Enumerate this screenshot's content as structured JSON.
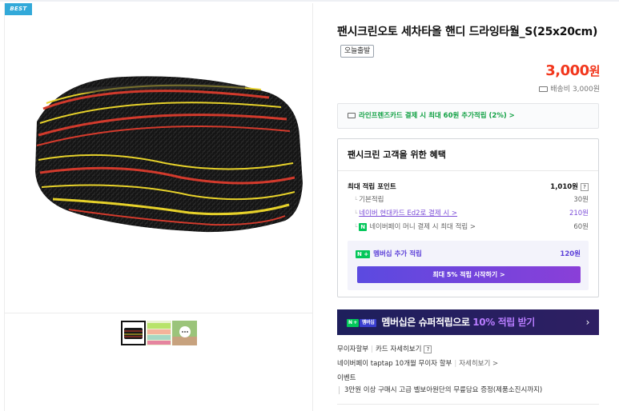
{
  "badge": "BEST",
  "product": {
    "title": "팬시크린오토 세차타올 핸디 드라잉타월_S(25x20cm)",
    "today_ship_badge": "오늘출발",
    "price": "3,000",
    "price_unit": "원",
    "shipping": "배송비 3,000원"
  },
  "card_banner": "라인프렌즈카드 결제 시 최대 60원 추가적립 (2%) >",
  "benefit": {
    "heading": "팬시크린 고객을 위한 혜택",
    "max_points_label": "최대 적립 포인트",
    "max_points_value": "1,010원",
    "help": "?",
    "rows": [
      {
        "label": "기본적립",
        "value": "30원"
      },
      {
        "label": "네이버 현대카드 Ed2로 결제 시 >",
        "value": "210원"
      },
      {
        "label": "네이버페이 머니 결제 시 최대 적립 >",
        "value": "60원"
      }
    ],
    "membership_label": "멤버십 추가 적립",
    "membership_value": "120원",
    "membership_button": "최대 5% 적립 시작하기 >",
    "n_badge": "N",
    "n_plus": "N +"
  },
  "super_banner": {
    "tag1": "N +",
    "tag2": "멤버십",
    "text_a": "멤버십은 슈퍼적립으로 ",
    "text_b": "10% 적립 받기",
    "arrow": "›"
  },
  "payment": {
    "installment": "무이자할부",
    "card_detail": "카드 자세히보기",
    "help": "?",
    "taptap": "네이버페이 taptap 10개월 무이자 할부",
    "taptap_detail": "자세히보기 >"
  },
  "event": {
    "label": "이벤트",
    "text": "3만원 이상 구매시 고급 벨보아원단의 무릎담요 증정(제품소진시까지)"
  },
  "colors": {
    "price": "#f2371d",
    "green": "#03c75a",
    "purple": "#7d4fd8",
    "best": "#32a9d9"
  },
  "icons": [
    "truck-icon",
    "card-icon",
    "naver-pay-icon",
    "chat-icon"
  ]
}
